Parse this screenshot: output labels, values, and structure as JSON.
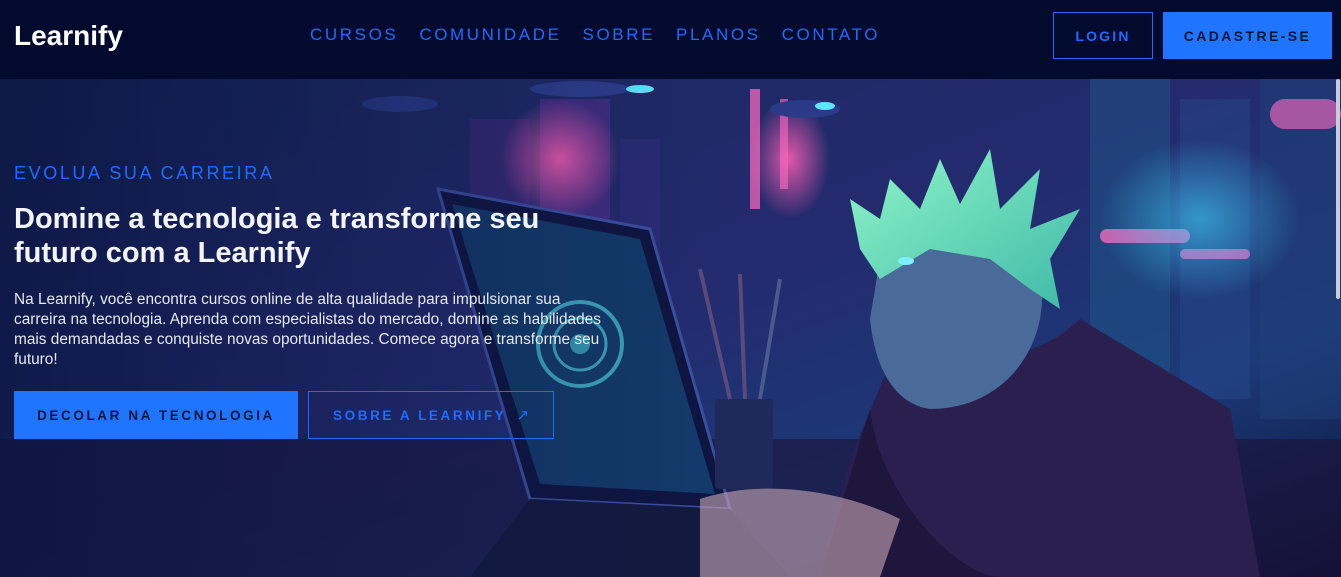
{
  "header": {
    "logo": "Learnify",
    "nav": [
      "CURSOS",
      "COMUNIDADE",
      "SOBRE",
      "PLANOS",
      "CONTATO"
    ],
    "login_label": "LOGIN",
    "signup_label": "CADASTRE-SE"
  },
  "hero": {
    "eyebrow": "EVOLUA SUA CARREIRA",
    "title": "Domine a tecnologia e transforme seu futuro com a Learnify",
    "description": "Na Learnify, você encontra cursos online de alta qualidade para impulsionar sua carreira na tecnologia. Aprenda com especialistas do mercado, domine as habilidades mais demandadas e conquiste novas oportunidades. Comece agora e transforme seu futuro!",
    "primary_cta": "DECOLAR NA TECNOLOGIA",
    "secondary_cta": "SOBRE A LEARNIFY",
    "secondary_icon": "arrow-up-right-icon"
  },
  "colors": {
    "background": "#020b2e",
    "accent": "#1f75ff",
    "accent_text": "#1f6bff"
  }
}
